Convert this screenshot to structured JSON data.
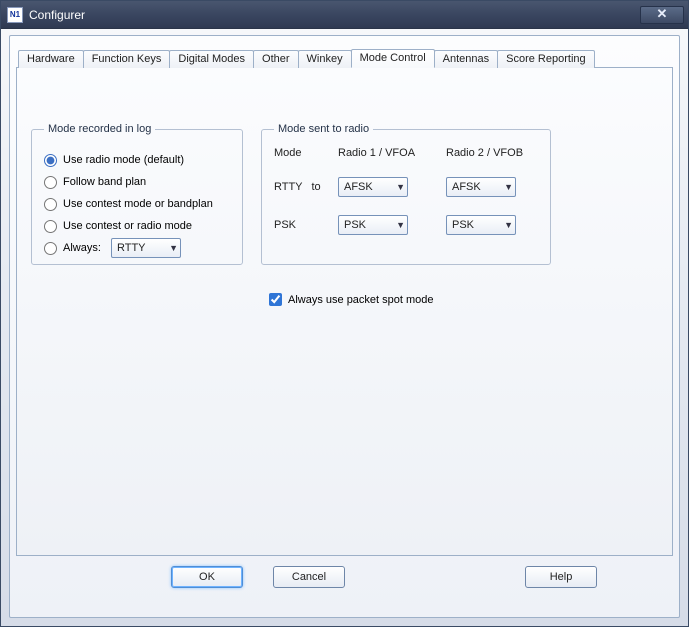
{
  "window": {
    "title": "Configurer",
    "icon_text": "N1"
  },
  "tabs": [
    {
      "label": "Hardware"
    },
    {
      "label": "Function Keys"
    },
    {
      "label": "Digital Modes"
    },
    {
      "label": "Other"
    },
    {
      "label": "Winkey"
    },
    {
      "label": "Mode Control"
    },
    {
      "label": "Antennas"
    },
    {
      "label": "Score Reporting"
    }
  ],
  "active_tab_index": 5,
  "group_log": {
    "legend": "Mode recorded in log",
    "options": [
      {
        "label": "Use radio mode (default)",
        "checked": true
      },
      {
        "label": "Follow band plan",
        "checked": false
      },
      {
        "label": "Use contest mode or bandplan",
        "checked": false
      },
      {
        "label": "Use contest or radio mode",
        "checked": false
      },
      {
        "label": "Always:",
        "checked": false
      }
    ],
    "always_mode_value": "RTTY"
  },
  "group_radio": {
    "legend": "Mode sent to radio",
    "col_mode": "Mode",
    "col_r1": "Radio 1 / VFOA",
    "col_r2": "Radio 2 / VFOB",
    "rows": [
      {
        "label": "RTTY   to",
        "r1": "AFSK",
        "r2": "AFSK"
      },
      {
        "label": "PSK",
        "r1": "PSK",
        "r2": "PSK"
      }
    ]
  },
  "packet": {
    "label": "Always use packet spot mode",
    "checked": true
  },
  "buttons": {
    "ok": "OK",
    "cancel": "Cancel",
    "help": "Help"
  }
}
